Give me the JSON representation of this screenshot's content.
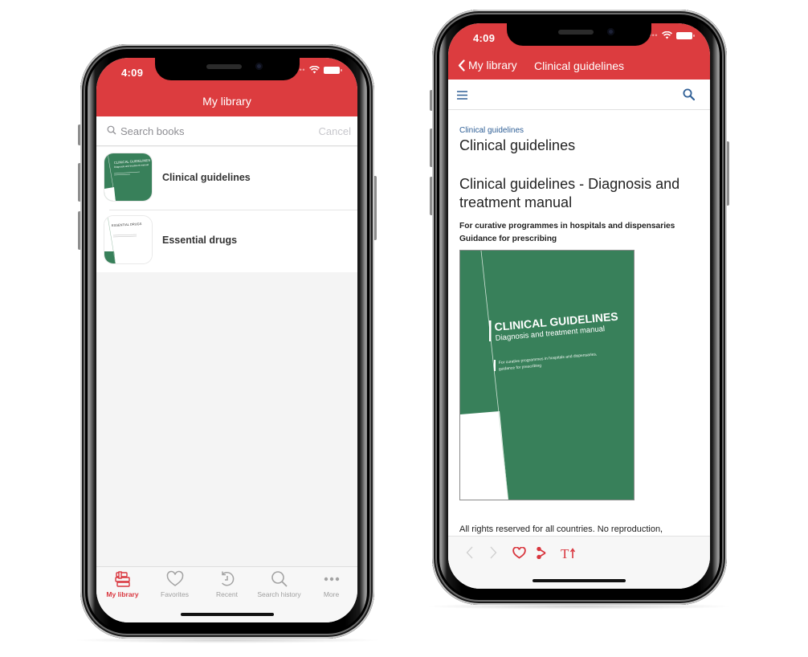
{
  "colors": {
    "brand_red": "#dc3c3f",
    "active_tab": "#d9363e",
    "link_blue": "#2f5f96",
    "cover_green": "#38805a"
  },
  "left_phone": {
    "status_bar": {
      "time": "4:09",
      "wifi_icon": "wifi-icon",
      "battery_icon": "battery-icon"
    },
    "nav_title": "My library",
    "search": {
      "placeholder": "Search books",
      "value": "",
      "cancel_label": "Cancel",
      "icon": "search-icon"
    },
    "books": [
      {
        "title": "Clinical guidelines",
        "thumb_label": "CLINICAL GUIDELINES",
        "thumb_sub": "Diagnosis and treatment manual"
      },
      {
        "title": "Essential drugs",
        "thumb_label": "ESSENTIAL DRUGS"
      }
    ],
    "tabs": [
      {
        "label": "My library",
        "icon": "books-icon",
        "active": true
      },
      {
        "label": "Favorites",
        "icon": "heart-icon",
        "active": false
      },
      {
        "label": "Recent",
        "icon": "history-icon",
        "active": false
      },
      {
        "label": "Search history",
        "icon": "search-icon",
        "active": false
      },
      {
        "label": "More",
        "icon": "more-dots-icon",
        "active": false
      }
    ]
  },
  "right_phone": {
    "status_bar": {
      "time": "4:09",
      "wifi_icon": "wifi-icon",
      "battery_icon": "battery-icon"
    },
    "back_label": "My library",
    "nav_title": "Clinical guidelines",
    "toolbar": {
      "menu_icon": "hamburger-menu-icon",
      "search_icon": "search-icon"
    },
    "content": {
      "breadcrumb": "Clinical guidelines",
      "heading": "Clinical guidelines",
      "subheading": "Clinical guidelines - Diagnosis and treatment manual",
      "subtitle_line1": "For curative programmes in hospitals and dispensaries",
      "subtitle_line2": "Guidance for prescribing",
      "cover": {
        "title": "CLINICAL GUIDELINES",
        "subtitle": "Diagnosis and treatment manual",
        "tagline_1": "For curative programmes in hospitals and dispensaries,",
        "tagline_2": "guidance for prescribing"
      },
      "rights_text": "All rights reserved for all countries. No reproduction,"
    },
    "reader_bar": [
      {
        "name": "previous-page",
        "icon": "chevron-left-icon",
        "enabled": false
      },
      {
        "name": "next-page",
        "icon": "chevron-right-icon",
        "enabled": false
      },
      {
        "name": "favorite",
        "icon": "heart-icon",
        "enabled": true
      },
      {
        "name": "share",
        "icon": "share-icon",
        "enabled": true
      },
      {
        "name": "text-size",
        "icon": "text-size-icon",
        "enabled": true
      }
    ]
  }
}
